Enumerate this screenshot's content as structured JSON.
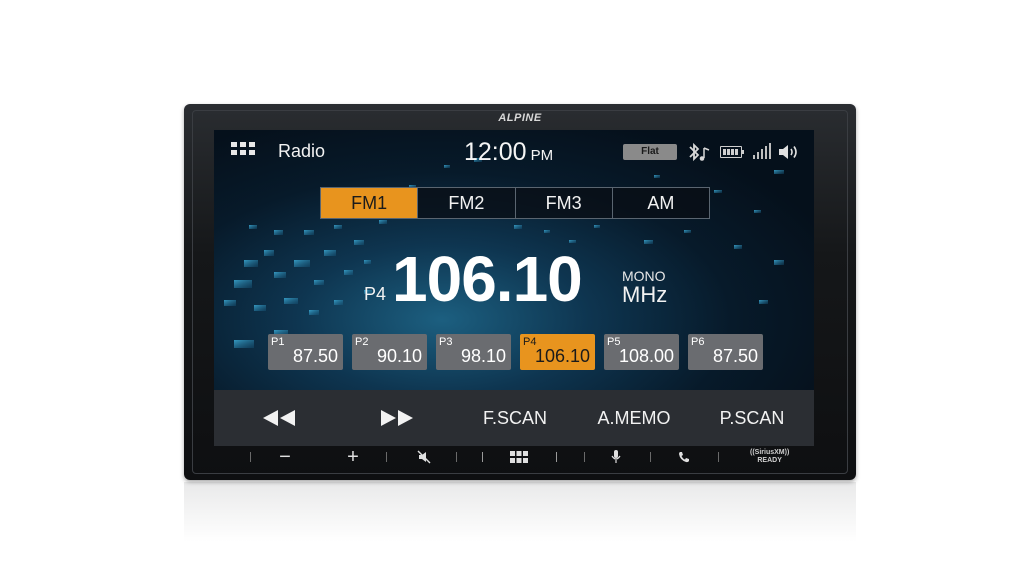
{
  "device": {
    "brand": "ALPINE"
  },
  "status": {
    "title": "Radio",
    "time": "12:00",
    "ampm": "PM",
    "eq_preset": "Flat",
    "icons": [
      "bluetooth-audio-icon",
      "battery-icon",
      "signal-strength-icon",
      "volume-icon"
    ]
  },
  "bands": [
    {
      "label": "FM1",
      "active": true
    },
    {
      "label": "FM2",
      "active": false
    },
    {
      "label": "FM3",
      "active": false
    },
    {
      "label": "AM",
      "active": false
    }
  ],
  "tuner": {
    "preset": "P4",
    "frequency": "106.10",
    "mode": "MONO",
    "unit": "MHz"
  },
  "presets": [
    {
      "number": "P1",
      "frequency": "87.50",
      "active": false
    },
    {
      "number": "P2",
      "frequency": "90.10",
      "active": false
    },
    {
      "number": "P3",
      "frequency": "98.10",
      "active": false
    },
    {
      "number": "P4",
      "frequency": "106.10",
      "active": true
    },
    {
      "number": "P5",
      "frequency": "108.00",
      "active": false
    },
    {
      "number": "P6",
      "frequency": "87.50",
      "active": false
    }
  ],
  "transport": {
    "rewind_icon": "rewind-icon",
    "forward_icon": "fast-forward-icon",
    "fscan": "F.SCAN",
    "amemo": "A.MEMO",
    "pscan": "P.SCAN"
  },
  "hardware_buttons": {
    "vol_down": "−",
    "vol_up": "+",
    "icons": [
      "mute-icon",
      "home-grid-icon",
      "microphone-icon",
      "phone-icon"
    ],
    "siriusxm_line1": "((SiriusXM))",
    "siriusxm_line2": "READY"
  },
  "colors": {
    "accent": "#e8941e",
    "preset_bg": "#6a6c70",
    "bar_bg": "#2b2e33"
  }
}
